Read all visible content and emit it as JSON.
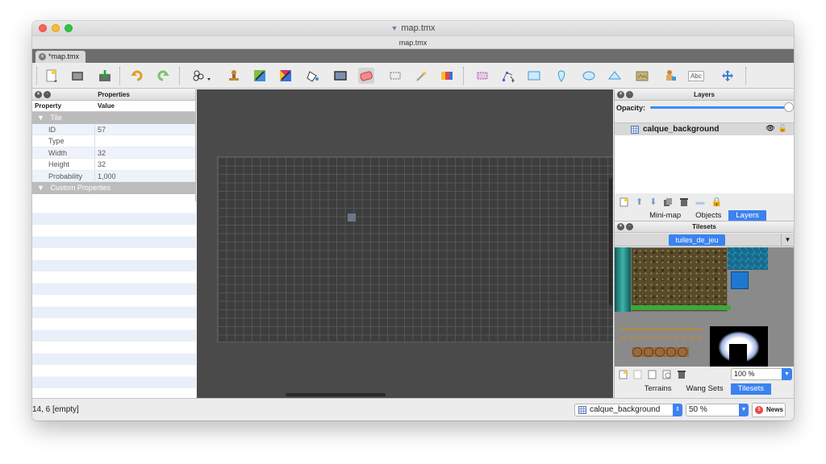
{
  "window": {
    "title": "map.tmx",
    "subtitle": "map.tmx",
    "doc_tab": "*map.tmx"
  },
  "toolbar": {
    "icons": [
      "new-map-icon",
      "open-icon",
      "save-icon",
      "undo-icon",
      "redo-icon",
      "random-icon",
      "stamp-brush-icon",
      "terrain-brush-icon",
      "wang-brush-icon",
      "bucket-fill-icon",
      "shape-fill-icon",
      "eraser-icon",
      "rect-select-icon",
      "magic-wand-icon",
      "select-same-icon",
      "select-objects-icon",
      "edit-polygons-icon",
      "insert-rect-icon",
      "insert-point-icon",
      "insert-ellipse-icon",
      "insert-polygon-icon",
      "insert-tile-icon",
      "insert-template-icon",
      "insert-text-icon",
      "move-icon"
    ],
    "text_tool_label": "Abc"
  },
  "properties": {
    "title": "Properties",
    "col_property": "Property",
    "col_value": "Value",
    "group_tile": "Tile",
    "rows": [
      {
        "key": "ID",
        "value": "57"
      },
      {
        "key": "Type",
        "value": ""
      },
      {
        "key": "Width",
        "value": "32"
      },
      {
        "key": "Height",
        "value": "32"
      },
      {
        "key": "Probability",
        "value": "1,000"
      }
    ],
    "group_custom": "Custom Properties",
    "foot_add": "+",
    "foot_remove": "−",
    "foot_edit": "/"
  },
  "layers": {
    "title": "Layers",
    "opacity_label": "Opacity:",
    "opacity_value": 1.0,
    "items": [
      {
        "name": "calque_background"
      }
    ],
    "dock_tabs": [
      "Mini-map",
      "Objects",
      "Layers"
    ],
    "dock_selected": "Layers"
  },
  "tilesets": {
    "title": "Tilesets",
    "active_tab": "tuiles_de_jeu",
    "zoom": "100 %",
    "dock_tabs": [
      "Terrains",
      "Wang Sets",
      "Tilesets"
    ],
    "dock_selected": "Tilesets"
  },
  "status": {
    "cursor": "14, 6 [empty]",
    "layer_select": "calque_background",
    "zoom_select": "50 %",
    "news_label": "News"
  },
  "colors": {
    "accent": "#3b82f0",
    "canvas_bg": "#4a4a4a",
    "grid_bg": "#3d3d3d"
  }
}
